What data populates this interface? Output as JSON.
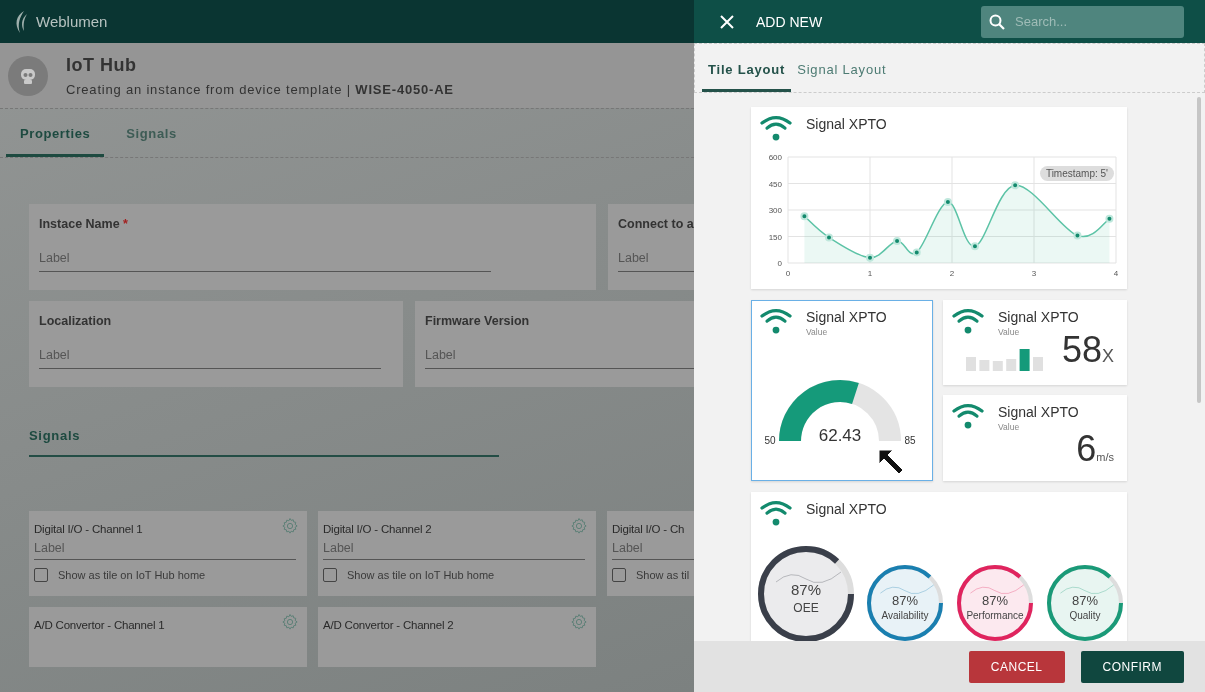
{
  "app_bar": {
    "brand": "Weblumen"
  },
  "page": {
    "title": "IoT Hub",
    "subtitle": "Creating an instance from device template | **WISE-4050-AE**"
  },
  "page_tabs": [
    {
      "label": "Properties",
      "selected": true
    },
    {
      "label": "Signals",
      "selected": false
    }
  ],
  "property_rows": [
    [
      {
        "label": "Instace Name",
        "required_mark": "*",
        "placeholder": "Label"
      },
      {
        "label": "Connect to a",
        "placeholder": "Label"
      }
    ],
    [
      {
        "label": "Localization",
        "placeholder": "Label"
      },
      {
        "label": "Firmware Version",
        "placeholder": "Label"
      }
    ]
  ],
  "signals_heading": "Signals",
  "channels": [
    {
      "kind": "field",
      "name": "Digital I/O - Channel 1",
      "placeholder": "Label",
      "checkbox_label": "Show as tile on IoT Hub home",
      "checked": false
    },
    {
      "kind": "field",
      "name": "Digital I/O - Channel 2",
      "placeholder": "Label",
      "checkbox_label": "Show as tile on IoT Hub home",
      "checked": false
    },
    {
      "kind": "field",
      "name": "Digital I/O - Ch",
      "placeholder": "Label",
      "checkbox_label": "Show as til",
      "checked": false
    },
    {
      "kind": "plain",
      "name": "A/D Convertor - Channel 1"
    },
    {
      "kind": "plain",
      "name": "A/D Convertor - Channel 2"
    }
  ],
  "drawer": {
    "title": "ADD NEW",
    "search": {
      "placeholder": "Search..."
    },
    "tabs": [
      {
        "label": "Tile Layout",
        "selected": true
      },
      {
        "label": "Signal Layout",
        "selected": false
      }
    ],
    "chart_tile": {
      "title": "Signal XPTO",
      "badge": "Timestamp: 5'",
      "chart_data": {
        "type": "area",
        "x": [
          0.2,
          0.5,
          1.0,
          1.33,
          1.57,
          1.95,
          2.28,
          2.77,
          3.53,
          3.92
        ],
        "grid": true,
        "series": [
          {
            "color": "#5cc3a6",
            "values": [
              265,
              145,
              30,
              125,
              60,
              345,
              95,
              440,
              155,
              250
            ]
          }
        ],
        "xlim": [
          0,
          4
        ],
        "ylim": [
          0,
          600
        ],
        "xticks": [
          0,
          1,
          2,
          3,
          4
        ],
        "yticks": [
          0,
          150,
          300,
          450,
          600
        ]
      }
    },
    "gauge_tile": {
      "title": "Signal XPTO",
      "subtitle": "Value",
      "selected": true,
      "min": "50",
      "max": "85",
      "value": "62.43",
      "level": 0.6
    },
    "bars_tile": {
      "title": "Signal XPTO",
      "subtitle": "Value",
      "value": "58",
      "unit": "X"
    },
    "number_tile": {
      "title": "Signal XPTO",
      "subtitle": "Value",
      "value": "6",
      "unit": "m/s"
    },
    "rings_tile": {
      "title": "Signal XPTO",
      "rings": [
        {
          "value": "87%",
          "label": "OEE",
          "color": "#3a3f4a",
          "level": 0.87
        },
        {
          "value": "87%",
          "label": "Availability",
          "color": "#1a7fb0",
          "level": 0.87
        },
        {
          "value": "87%",
          "label": "Performance",
          "color": "#e0245e",
          "level": 0.87
        },
        {
          "value": "87%",
          "label": "Quality",
          "color": "#1a9a78",
          "level": 0.87
        }
      ]
    },
    "buttons": {
      "cancel": "CANCEL",
      "confirm": "CONFIRM"
    }
  }
}
